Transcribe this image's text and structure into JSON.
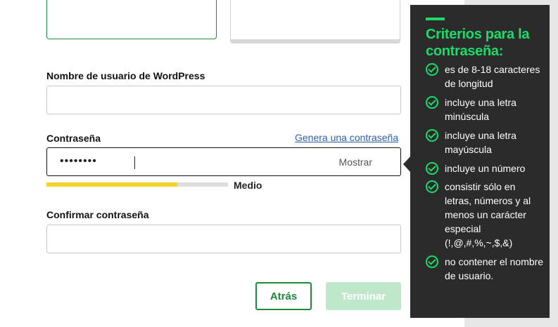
{
  "form": {
    "username_label": "Nombre de usuario de WordPress",
    "username_value": "",
    "password_label": "Contraseña",
    "generate_link": "Genera una contraseña",
    "password_masked": "••••••••",
    "show_label": "Mostrar",
    "strength": {
      "label": "Medio",
      "level": 0.72
    },
    "confirm_label": "Confirmar contraseña",
    "confirm_value": ""
  },
  "buttons": {
    "back": "Atrás",
    "finish": "Terminar"
  },
  "tooltip": {
    "title": "Criterios para la contraseña:",
    "criteria": [
      {
        "text": "es de 8-18 caracteres de longitud"
      },
      {
        "text": "incluye una letra minúscula"
      },
      {
        "text": "incluye una letra mayúscula"
      },
      {
        "text": "incluye un número"
      },
      {
        "text": "consistir sólo en letras, números y al menos un carácter especial (!,@,#,%,~,$,&)"
      },
      {
        "text": "no contener el nombre de usuario."
      }
    ]
  },
  "colors": {
    "accent_green": "#1a8a3b",
    "tooltip_green": "#1bdb6b",
    "strength_medium": "#f5d328",
    "tooltip_bg": "#2b2b2b"
  }
}
